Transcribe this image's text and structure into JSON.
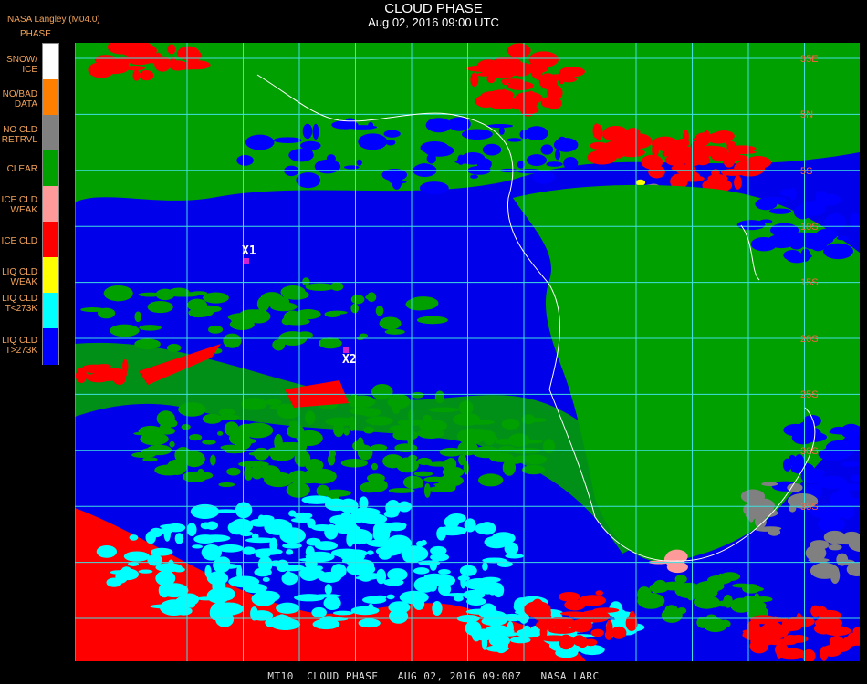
{
  "header": {
    "title": "CLOUD PHASE",
    "subtitle": "Aug 02, 2016 09:00 UTC"
  },
  "source": "NASA Langley (M04.0)",
  "legend": {
    "title": "PHASE",
    "items": [
      {
        "label": "SNOW/\nICE",
        "color": "#ffffff"
      },
      {
        "label": "NO/BAD\nDATA",
        "color": "#ff8000"
      },
      {
        "label": "NO CLD\nRETRVL",
        "color": "#808080"
      },
      {
        "label": "CLEAR",
        "color": "#00a000"
      },
      {
        "label": "ICE CLD\nWEAK",
        "color": "#ff9a9a"
      },
      {
        "label": "ICE CLD",
        "color": "#ff0000"
      },
      {
        "label": "LIQ CLD\nWEAK",
        "color": "#ffff00"
      },
      {
        "label": "LIQ CLD\nT<273K",
        "color": "#00ffff"
      },
      {
        "label": "LIQ CLD\nT>273K",
        "color": "#0000ff"
      }
    ]
  },
  "map": {
    "background_color": "#0000ea",
    "grid_color": "#40e0e0",
    "latitude_labels": [
      "35E",
      "5N",
      "5S",
      "10S",
      "15S",
      "20S",
      "25S",
      "30S",
      "35S"
    ],
    "markers": [
      {
        "label": "X1"
      },
      {
        "label": "X2"
      }
    ]
  },
  "footer": "MT10  CLOUD PHASE   AUG 02, 2016 09:00Z   NASA LARC"
}
